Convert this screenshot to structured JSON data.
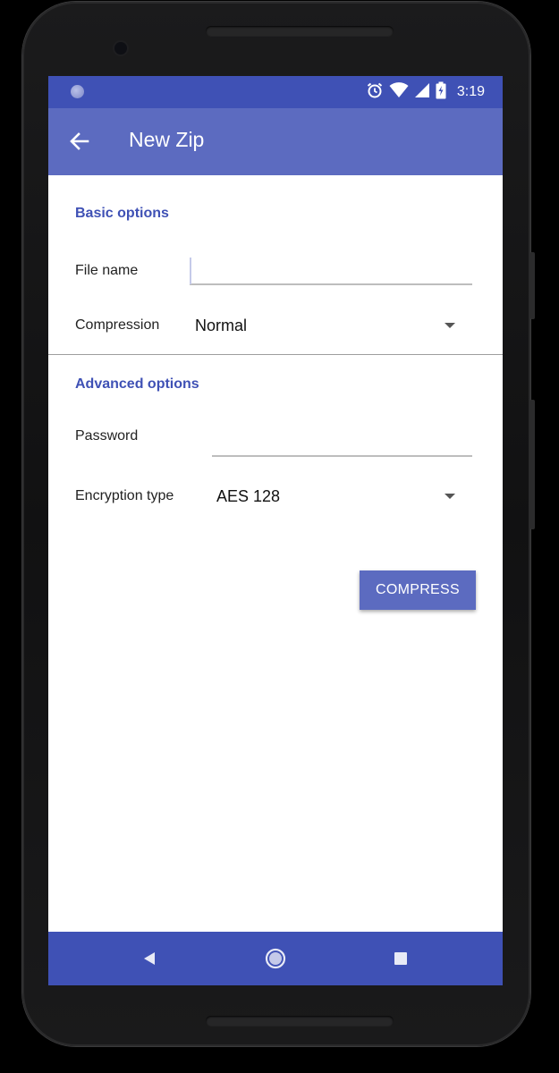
{
  "status_bar": {
    "time": "3:19",
    "icons": [
      "notification-dot-icon",
      "alarm-icon",
      "wifi-icon",
      "signal-icon",
      "battery-icon"
    ]
  },
  "app_bar": {
    "title": "New Zip",
    "back_icon": "arrow-back-icon"
  },
  "basic_options": {
    "section_title": "Basic options",
    "file_name": {
      "label": "File name",
      "value": "",
      "placeholder": ""
    },
    "compression": {
      "label": "Compression",
      "selected": "Normal"
    }
  },
  "advanced_options": {
    "section_title": "Advanced options",
    "password": {
      "label": "Password",
      "value": "",
      "placeholder": ""
    },
    "encryption": {
      "label": "Encryption type",
      "selected": "AES 128"
    }
  },
  "actions": {
    "compress_label": "COMPRESS"
  },
  "nav_bar": {
    "icons": [
      "back-triangle-icon",
      "home-circle-icon",
      "recents-square-icon"
    ]
  },
  "colors": {
    "status_bar": "#3f51b5",
    "app_bar": "#5c6bc0",
    "accent": "#3f51b5",
    "nav_bar": "#3f51b5"
  }
}
